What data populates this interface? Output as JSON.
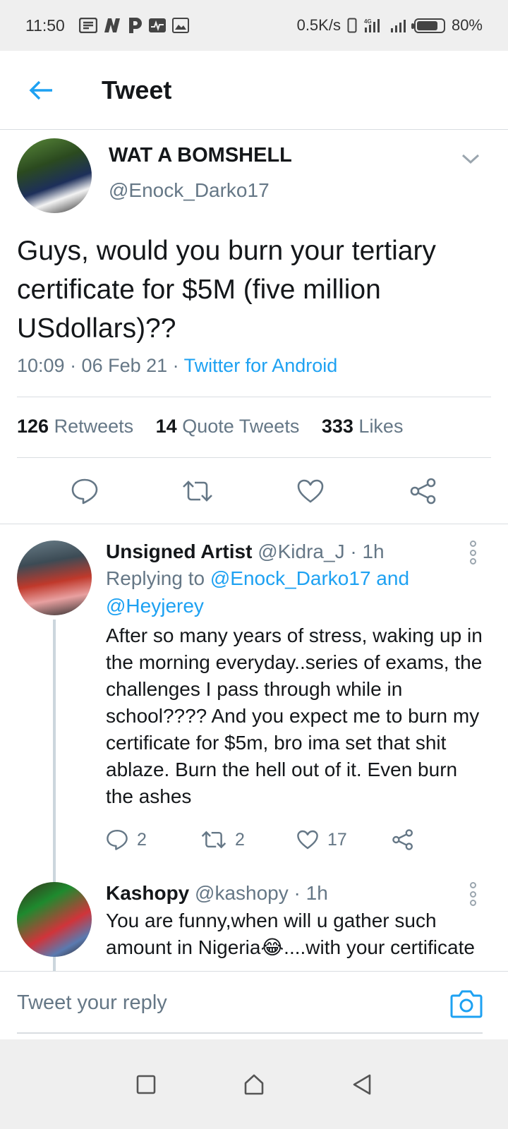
{
  "status_bar": {
    "time": "11:50",
    "notification_icons": [
      "message-icon",
      "n-app-icon",
      "p-app-icon",
      "activity-icon",
      "image-icon"
    ],
    "net_speed": "0.5K/s",
    "battery": "80%",
    "battery_level": 0.8
  },
  "header": {
    "title": "Tweet",
    "back_icon": "arrow-left-icon"
  },
  "tweet": {
    "author_name": "WAT A BOMSHELL",
    "author_handle": "@Enock_Darko17",
    "text": "Guys, would you burn your tertiary certificate for $5M (five million USdollars)??",
    "timestamp": "10:09 · 06 Feb 21 · ",
    "source": "Twitter for Android",
    "stats": {
      "retweets_count": "126",
      "retweets_label": "Retweets",
      "quotes_count": "14",
      "quotes_label": "Quote Tweets",
      "likes_count": "333",
      "likes_label": "Likes"
    }
  },
  "replies": [
    {
      "name": "Unsigned Artist",
      "handle_time": " @Kidra_J · 1h",
      "replying_prefix": "Replying to ",
      "replying_to": "@Enock_Darko17 and @Heyjerey",
      "text": "After so many years of stress, waking up in the morning everyday..series of exams, the challenges I pass through while in school???? And you expect me to burn my certificate for $5m, bro ima set that shit ablaze. Burn the hell out of it. Even burn the ashes",
      "reply_count": "2",
      "retweet_count": "2",
      "like_count": "17"
    },
    {
      "name": "Kashopy",
      "handle_time": " @kashopy · 1h",
      "text": "You are funny,when will u gather such amount in Nigeria😂....with your certificate"
    }
  ],
  "composer": {
    "placeholder": "Tweet your reply"
  },
  "colors": {
    "accent": "#1da1f2",
    "text": "#14171a",
    "muted": "#657786",
    "divider": "#d9dde1"
  }
}
